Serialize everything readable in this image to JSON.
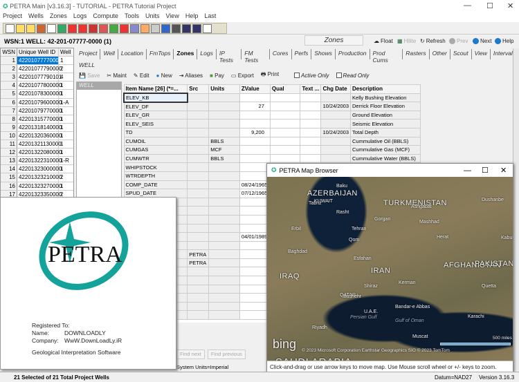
{
  "window": {
    "title": "PETRA Main [v3.16.3] - TUTORIAL - PETRA Tutorial Project",
    "minimize": "—",
    "maximize": "☐",
    "close": "✕"
  },
  "menu": [
    "Project",
    "Wells",
    "Zones",
    "Logs",
    "Compute",
    "Tools",
    "Units",
    "View",
    "Help",
    "Last"
  ],
  "wsn_line": "WSN:1   WELL: 42-201-07777-0000 (1)",
  "header": {
    "zones_label": "Zones",
    "float": "Float",
    "hilite": "Hilite",
    "refresh": "Refresh",
    "prev": "Prev",
    "next": "Next",
    "help": "Help"
  },
  "wells": {
    "headers": [
      "WSN",
      "Unique Well ID",
      "Well"
    ],
    "rows": [
      [
        "1",
        "42201077770000",
        "1"
      ],
      [
        "2",
        "42201077790000",
        "2"
      ],
      [
        "3",
        "42201077790101",
        "4"
      ],
      [
        "4",
        "42201077800000",
        "1"
      ],
      [
        "5",
        "42201078300000",
        "1"
      ],
      [
        "6",
        "42201079600000",
        "1-A"
      ],
      [
        "7",
        "42201079770000",
        "1"
      ],
      [
        "8",
        "42201315770000",
        "1"
      ],
      [
        "9",
        "42201318140000",
        "1"
      ],
      [
        "10",
        "42201320360000",
        "1"
      ],
      [
        "11",
        "42201321130000",
        "1"
      ],
      [
        "12",
        "42201322080000",
        "1"
      ],
      [
        "13",
        "42201322310000",
        "1-R"
      ],
      [
        "14",
        "42201323000000",
        "1"
      ],
      [
        "15",
        "42201323210000",
        "2"
      ],
      [
        "16",
        "42201323270000",
        "1"
      ],
      [
        "17",
        "42201323350000",
        "2"
      ]
    ]
  },
  "tabs": [
    "Project",
    "Well",
    "Location",
    "FmTops",
    "Zones",
    "Logs",
    "IP Tests",
    "FM Tests",
    "Cores",
    "Perfs",
    "Shows",
    "Production",
    "Prod Cums",
    "Rasters",
    "Other",
    "Scout",
    "View",
    "Intervals"
  ],
  "active_tab": "Zones",
  "zone_section": "WELL",
  "actions": {
    "save": "Save",
    "maint": "Maint",
    "edit": "Edit",
    "new": "New",
    "aliases": "Aliases",
    "pay": "Pay",
    "export": "Export",
    "print": "Print",
    "active_only": "Active Only",
    "read_only": "Read Only"
  },
  "well_panel": "WELL",
  "grid": {
    "headers": [
      "Item Name [26] (*=...",
      "Src",
      "Units",
      "ZValue",
      "Qual",
      "Text ...",
      "Chg Date",
      "Description"
    ],
    "rows": [
      [
        "ELEV_KB",
        "",
        "",
        "",
        "",
        "",
        "",
        "Kelly Bushing Elevation"
      ],
      [
        "ELEV_DF",
        "",
        "",
        "27",
        "",
        "",
        "10/24/2003",
        "Derrick Floor Elevation"
      ],
      [
        "ELEV_GR",
        "",
        "",
        "",
        "",
        "",
        "",
        "Ground Elevation"
      ],
      [
        "ELEV_SEIS",
        "",
        "",
        "",
        "",
        "",
        "",
        "Seismic Elevation"
      ],
      [
        "TD",
        "",
        "",
        "9,200",
        "",
        "",
        "10/24/2003",
        "Total Depth"
      ],
      [
        "CUMOIL",
        "",
        "BBLS",
        "",
        "",
        "",
        "",
        "Cummulative Oil  (BBLS)"
      ],
      [
        "CUMGAS",
        "",
        "MCF",
        "",
        "",
        "",
        "",
        "Cummulative Gas  (MCF)"
      ],
      [
        "CUMWTR",
        "",
        "BBLS",
        "",
        "",
        "",
        "",
        "Cummulative Water  (BBLS)"
      ],
      [
        "WHIPSTOCK",
        "",
        "",
        "",
        "",
        "",
        "",
        ""
      ],
      [
        "WTRDEPTH",
        "",
        "",
        "",
        "",
        "",
        "",
        ""
      ],
      [
        "COMP_DATE",
        "",
        "",
        "08/24/1965",
        "",
        "",
        "",
        ""
      ],
      [
        "SPUD_DATE",
        "",
        "",
        "07/12/1965",
        "",
        "",
        "",
        ""
      ],
      [
        "",
        "",
        "",
        "",
        "",
        "",
        "",
        ""
      ],
      [
        "",
        "",
        "",
        "",
        "",
        "",
        "",
        ""
      ],
      [
        "",
        "",
        "",
        "",
        "",
        "",
        "",
        ""
      ],
      [
        "",
        "",
        "",
        "",
        "",
        "",
        "",
        ""
      ],
      [
        "",
        "",
        "",
        "04/01/1989",
        "",
        "",
        "",
        ""
      ],
      [
        "",
        "",
        "",
        "",
        "",
        "",
        "",
        ""
      ],
      [
        "",
        "PETRA",
        "",
        "",
        "",
        "",
        "",
        ""
      ],
      [
        "",
        "PETRA",
        "",
        "",
        "",
        "",
        "",
        ""
      ],
      [
        "",
        "",
        "",
        "",
        "",
        "",
        "",
        ""
      ],
      [
        "",
        "",
        "",
        "",
        "",
        "",
        "",
        ""
      ],
      [
        "",
        "",
        "",
        "",
        "",
        "",
        "",
        ""
      ],
      [
        "",
        "",
        "",
        "",
        "",
        "",
        "",
        ""
      ],
      [
        "",
        "",
        "",
        "",
        "",
        "",
        "",
        ""
      ],
      [
        "",
        "",
        "",
        "",
        "",
        "",
        "",
        ""
      ]
    ]
  },
  "find": {
    "next": "Find next",
    "previous": "Find previous"
  },
  "system_units": "System Units=Imperial",
  "splash": {
    "logo": "PETRA",
    "registered_to": "Registered To:",
    "name_label": "Name:",
    "name": "DOWNLOADLY",
    "company_label": "Company:",
    "company": "WwW.DownLoadLy.iR",
    "tagline": "Geological Interpretation Software"
  },
  "map_window": {
    "title": "PETRA Map Browser",
    "hint": "Click-and-drag or use arrow keys to move map. Use Mouse scroll wheel or +/- keys to zoom.",
    "scale": "500 miles",
    "attribution": "© 2023 Microsoft Corporation   Earthstar Geographics SIO   © 2023 TomTom",
    "bing": "bing",
    "countries": [
      "TURKMENISTAN",
      "AZERBAIJAN",
      "IRAN",
      "IRAQ",
      "AFGHANISTAN",
      "PAKISTAN",
      "KUWAIT",
      "QATAR",
      "U.A.E.",
      "SAUDI ARABIA"
    ],
    "cities": [
      "Baku",
      "Tabriz",
      "Rasht",
      "Tehran",
      "Qom",
      "Ashgabat",
      "Mashhad",
      "Herat",
      "Kabul",
      "Baghdad",
      "Esfahan",
      "Shiraz",
      "Kerman",
      "Bushehr",
      "Bandar-e Abbas",
      "Muscat",
      "Riyadh",
      "Karachi",
      "Quetta",
      "Dushanbe",
      "Gorgan",
      "Erbil",
      "Persian Gulf",
      "Gulf of Oman"
    ]
  },
  "status": {
    "selection": "21 Selected of 21 Total Project Wells",
    "datum": "Datum=NAD27",
    "version": "Version 3.16.3"
  }
}
